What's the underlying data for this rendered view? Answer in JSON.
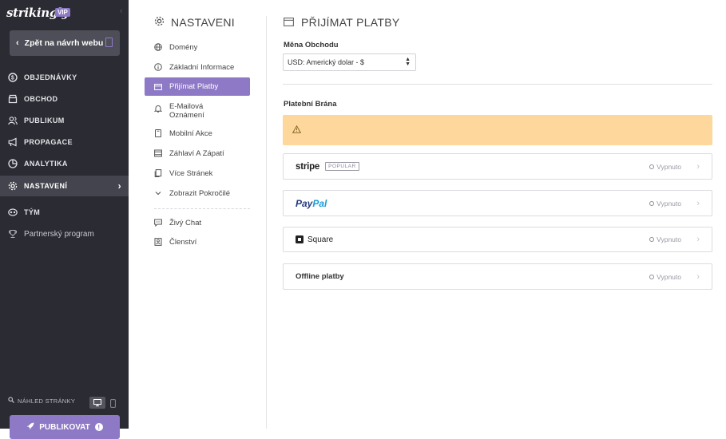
{
  "brand": {
    "name": "strikingly",
    "badge": "VIP"
  },
  "sidebar": {
    "back_label": "Zpět na návrh webu",
    "items": [
      {
        "label": "OBJEDNÁVKY",
        "icon": "dollar-circle-icon"
      },
      {
        "label": "OBCHOD",
        "icon": "store-icon"
      },
      {
        "label": "PUBLIKUM",
        "icon": "people-icon"
      },
      {
        "label": "PROPAGACE",
        "icon": "megaphone-icon"
      },
      {
        "label": "ANALYTIKA",
        "icon": "pie-chart-icon"
      },
      {
        "label": "NASTAVENÍ",
        "icon": "gear-icon",
        "active": true
      },
      {
        "label": "TÝM",
        "icon": "team-icon"
      },
      {
        "label": "Partnerský program",
        "icon": "trophy-icon"
      }
    ],
    "preview_label": "NÁHLED STRÁNKY",
    "publish_label": "PUBLIKOVAT",
    "publish_badge": "!"
  },
  "settings_nav": {
    "title": "NASTAVENI",
    "items": [
      {
        "label": "Domény",
        "icon": "globe-icon"
      },
      {
        "label": "Základní Informace",
        "icon": "info-icon"
      },
      {
        "label": "Přijímat Platby",
        "icon": "credit-card-icon",
        "active": true
      },
      {
        "label": "E-Mailová Oznámení",
        "icon": "bell-icon"
      },
      {
        "label": "Mobilní Akce",
        "icon": "tablet-icon"
      },
      {
        "label": "Záhlaví A Zápatí",
        "icon": "header-footer-icon"
      },
      {
        "label": "Více Stránek",
        "icon": "pages-icon"
      },
      {
        "label": "Zobrazit Pokročilé",
        "icon": "chevron-down-icon"
      },
      {
        "label": "Živý Chat",
        "icon": "chat-icon"
      },
      {
        "label": "Členství",
        "icon": "membership-icon"
      }
    ]
  },
  "main": {
    "title": "PŘIJÍMAT PLATBY",
    "currency_label": "Měna Obchodu",
    "currency_value": "USD: Americký dolar - $",
    "gateway_label": "Platební Brána",
    "warning_icon": "warning-icon",
    "gateways": [
      {
        "name": "stripe",
        "tag": "POPULAR",
        "status": "Vypnuto"
      },
      {
        "name_a": "Pay",
        "name_b": "Pal",
        "status": "Vypnuto"
      },
      {
        "name": "Square",
        "status": "Vypnuto"
      },
      {
        "name": "Offline platby",
        "status": "Vypnuto"
      }
    ]
  },
  "colors": {
    "accent": "#8e79c6",
    "sidebar_bg": "#2b2b33",
    "warning_bg": "#fdd79b"
  }
}
